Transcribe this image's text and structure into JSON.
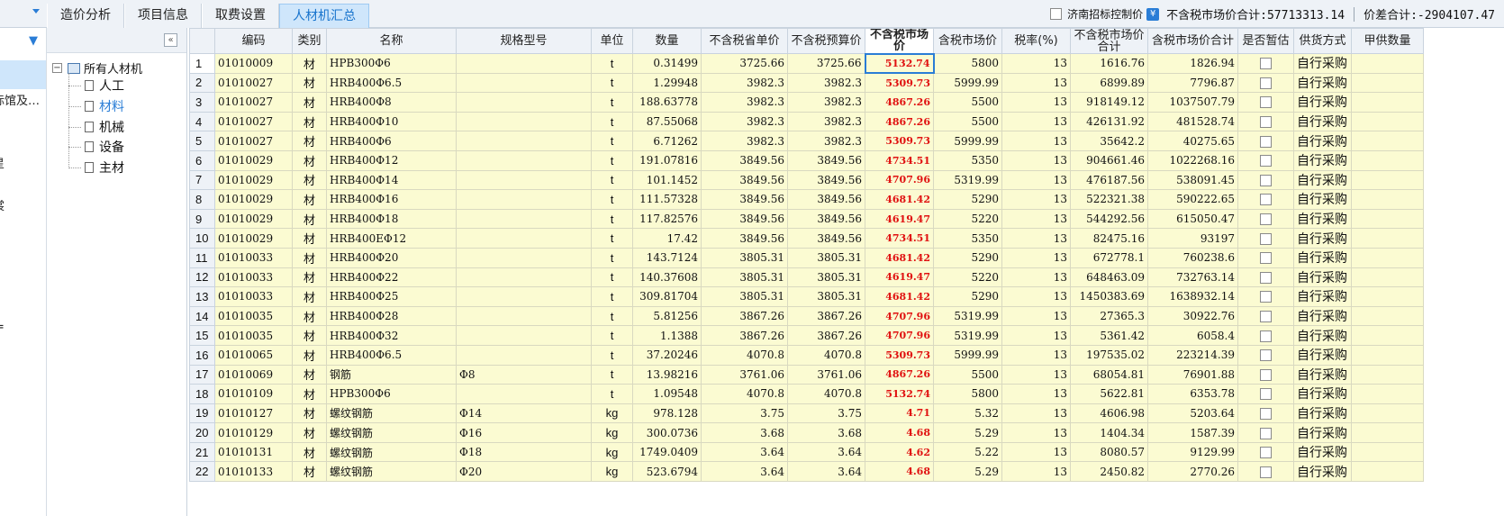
{
  "tabs": [
    {
      "label": "造价分析",
      "active": false
    },
    {
      "label": "项目信息",
      "active": false
    },
    {
      "label": "取费设置",
      "active": false
    },
    {
      "label": "人材机汇总",
      "active": true
    }
  ],
  "topright": {
    "control_label": "济南招标控制价",
    "control_checked": false,
    "tax_excluded_total": "不含税市场价合计:57713313.14",
    "price_diff_total": "价差合计:-2904107.47"
  },
  "leftnav": {
    "partial_items": [
      "标馆及…",
      "星",
      "裳",
      "="
    ]
  },
  "tree": {
    "root_label": "所有人材机",
    "root_toggle": "−",
    "children": [
      {
        "label": "人工",
        "selected": false
      },
      {
        "label": "材料",
        "selected": true
      },
      {
        "label": "机械",
        "selected": false
      },
      {
        "label": "设备",
        "selected": false
      },
      {
        "label": "主材",
        "selected": false
      }
    ],
    "collapse_glyph": "«"
  },
  "table": {
    "headers": [
      "",
      "编码",
      "类别",
      "名称",
      "规格型号",
      "单位",
      "数量",
      "不含税省单价",
      "不含税预算价",
      "不含税市场价",
      "含税市场价",
      "税率(%)",
      "不含税市场价合计",
      "含税市场价合计",
      "是否暂估",
      "供货方式",
      "甲供数量"
    ],
    "rows": [
      {
        "n": "1",
        "code": "01010009",
        "cat": "材",
        "name": "HPB300Φ6",
        "spec": "",
        "unit": "t",
        "qty": "0.31499",
        "prov": "3725.66",
        "budget": "3725.66",
        "market": "5132.74",
        "market_tax": "5800",
        "rate": "13",
        "sum": "1616.76",
        "sum_tax": "1826.94",
        "supply": "自行采购"
      },
      {
        "n": "2",
        "code": "01010027",
        "cat": "材",
        "name": "HRB400Φ6.5",
        "spec": "",
        "unit": "t",
        "qty": "1.29948",
        "prov": "3982.3",
        "budget": "3982.3",
        "market": "5309.73",
        "market_tax": "5999.99",
        "rate": "13",
        "sum": "6899.89",
        "sum_tax": "7796.87",
        "supply": "自行采购"
      },
      {
        "n": "3",
        "code": "01010027",
        "cat": "材",
        "name": "HRB400Φ8",
        "spec": "",
        "unit": "t",
        "qty": "188.63778",
        "prov": "3982.3",
        "budget": "3982.3",
        "market": "4867.26",
        "market_tax": "5500",
        "rate": "13",
        "sum": "918149.12",
        "sum_tax": "1037507.79",
        "supply": "自行采购"
      },
      {
        "n": "4",
        "code": "01010027",
        "cat": "材",
        "name": "HRB400Φ10",
        "spec": "",
        "unit": "t",
        "qty": "87.55068",
        "prov": "3982.3",
        "budget": "3982.3",
        "market": "4867.26",
        "market_tax": "5500",
        "rate": "13",
        "sum": "426131.92",
        "sum_tax": "481528.74",
        "supply": "自行采购"
      },
      {
        "n": "5",
        "code": "01010027",
        "cat": "材",
        "name": "HRB400Φ6",
        "spec": "",
        "unit": "t",
        "qty": "6.71262",
        "prov": "3982.3",
        "budget": "3982.3",
        "market": "5309.73",
        "market_tax": "5999.99",
        "rate": "13",
        "sum": "35642.2",
        "sum_tax": "40275.65",
        "supply": "自行采购"
      },
      {
        "n": "6",
        "code": "01010029",
        "cat": "材",
        "name": "HRB400Φ12",
        "spec": "",
        "unit": "t",
        "qty": "191.07816",
        "prov": "3849.56",
        "budget": "3849.56",
        "market": "4734.51",
        "market_tax": "5350",
        "rate": "13",
        "sum": "904661.46",
        "sum_tax": "1022268.16",
        "supply": "自行采购"
      },
      {
        "n": "7",
        "code": "01010029",
        "cat": "材",
        "name": "HRB400Φ14",
        "spec": "",
        "unit": "t",
        "qty": "101.1452",
        "prov": "3849.56",
        "budget": "3849.56",
        "market": "4707.96",
        "market_tax": "5319.99",
        "rate": "13",
        "sum": "476187.56",
        "sum_tax": "538091.45",
        "supply": "自行采购"
      },
      {
        "n": "8",
        "code": "01010029",
        "cat": "材",
        "name": "HRB400Φ16",
        "spec": "",
        "unit": "t",
        "qty": "111.57328",
        "prov": "3849.56",
        "budget": "3849.56",
        "market": "4681.42",
        "market_tax": "5290",
        "rate": "13",
        "sum": "522321.38",
        "sum_tax": "590222.65",
        "supply": "自行采购"
      },
      {
        "n": "9",
        "code": "01010029",
        "cat": "材",
        "name": "HRB400Φ18",
        "spec": "",
        "unit": "t",
        "qty": "117.82576",
        "prov": "3849.56",
        "budget": "3849.56",
        "market": "4619.47",
        "market_tax": "5220",
        "rate": "13",
        "sum": "544292.56",
        "sum_tax": "615050.47",
        "supply": "自行采购"
      },
      {
        "n": "10",
        "code": "01010029",
        "cat": "材",
        "name": "HRB400EΦ12",
        "spec": "",
        "unit": "t",
        "qty": "17.42",
        "prov": "3849.56",
        "budget": "3849.56",
        "market": "4734.51",
        "market_tax": "5350",
        "rate": "13",
        "sum": "82475.16",
        "sum_tax": "93197",
        "supply": "自行采购"
      },
      {
        "n": "11",
        "code": "01010033",
        "cat": "材",
        "name": "HRB400Φ20",
        "spec": "",
        "unit": "t",
        "qty": "143.7124",
        "prov": "3805.31",
        "budget": "3805.31",
        "market": "4681.42",
        "market_tax": "5290",
        "rate": "13",
        "sum": "672778.1",
        "sum_tax": "760238.6",
        "supply": "自行采购"
      },
      {
        "n": "12",
        "code": "01010033",
        "cat": "材",
        "name": "HRB400Φ22",
        "spec": "",
        "unit": "t",
        "qty": "140.37608",
        "prov": "3805.31",
        "budget": "3805.31",
        "market": "4619.47",
        "market_tax": "5220",
        "rate": "13",
        "sum": "648463.09",
        "sum_tax": "732763.14",
        "supply": "自行采购"
      },
      {
        "n": "13",
        "code": "01010033",
        "cat": "材",
        "name": "HRB400Φ25",
        "spec": "",
        "unit": "t",
        "qty": "309.81704",
        "prov": "3805.31",
        "budget": "3805.31",
        "market": "4681.42",
        "market_tax": "5290",
        "rate": "13",
        "sum": "1450383.69",
        "sum_tax": "1638932.14",
        "supply": "自行采购"
      },
      {
        "n": "14",
        "code": "01010035",
        "cat": "材",
        "name": "HRB400Φ28",
        "spec": "",
        "unit": "t",
        "qty": "5.81256",
        "prov": "3867.26",
        "budget": "3867.26",
        "market": "4707.96",
        "market_tax": "5319.99",
        "rate": "13",
        "sum": "27365.3",
        "sum_tax": "30922.76",
        "supply": "自行采购"
      },
      {
        "n": "15",
        "code": "01010035",
        "cat": "材",
        "name": "HRB400Φ32",
        "spec": "",
        "unit": "t",
        "qty": "1.1388",
        "prov": "3867.26",
        "budget": "3867.26",
        "market": "4707.96",
        "market_tax": "5319.99",
        "rate": "13",
        "sum": "5361.42",
        "sum_tax": "6058.4",
        "supply": "自行采购"
      },
      {
        "n": "16",
        "code": "01010065",
        "cat": "材",
        "name": "HRB400Φ6.5",
        "spec": "",
        "unit": "t",
        "qty": "37.20246",
        "prov": "4070.8",
        "budget": "4070.8",
        "market": "5309.73",
        "market_tax": "5999.99",
        "rate": "13",
        "sum": "197535.02",
        "sum_tax": "223214.39",
        "supply": "自行采购"
      },
      {
        "n": "17",
        "code": "01010069",
        "cat": "材",
        "name": "钢筋",
        "spec": "Φ8",
        "unit": "t",
        "qty": "13.98216",
        "prov": "3761.06",
        "budget": "3761.06",
        "market": "4867.26",
        "market_tax": "5500",
        "rate": "13",
        "sum": "68054.81",
        "sum_tax": "76901.88",
        "supply": "自行采购"
      },
      {
        "n": "18",
        "code": "01010109",
        "cat": "材",
        "name": "HPB300Φ6",
        "spec": "",
        "unit": "t",
        "qty": "1.09548",
        "prov": "4070.8",
        "budget": "4070.8",
        "market": "5132.74",
        "market_tax": "5800",
        "rate": "13",
        "sum": "5622.81",
        "sum_tax": "6353.78",
        "supply": "自行采购"
      },
      {
        "n": "19",
        "code": "01010127",
        "cat": "材",
        "name": "螺纹钢筋",
        "spec": "Φ14",
        "unit": "kg",
        "qty": "978.128",
        "prov": "3.75",
        "budget": "3.75",
        "market": "4.71",
        "market_tax": "5.32",
        "rate": "13",
        "sum": "4606.98",
        "sum_tax": "5203.64",
        "supply": "自行采购"
      },
      {
        "n": "20",
        "code": "01010129",
        "cat": "材",
        "name": "螺纹钢筋",
        "spec": "Φ16",
        "unit": "kg",
        "qty": "300.0736",
        "prov": "3.68",
        "budget": "3.68",
        "market": "4.68",
        "market_tax": "5.29",
        "rate": "13",
        "sum": "1404.34",
        "sum_tax": "1587.39",
        "supply": "自行采购"
      },
      {
        "n": "21",
        "code": "01010131",
        "cat": "材",
        "name": "螺纹钢筋",
        "spec": "Φ18",
        "unit": "kg",
        "qty": "1749.0409",
        "prov": "3.64",
        "budget": "3.64",
        "market": "4.62",
        "market_tax": "5.22",
        "rate": "13",
        "sum": "8080.57",
        "sum_tax": "9129.99",
        "supply": "自行采购"
      },
      {
        "n": "22",
        "code": "01010133",
        "cat": "材",
        "name": "螺纹钢筋",
        "spec": "Φ20",
        "unit": "kg",
        "qty": "523.6794",
        "prov": "3.64",
        "budget": "3.64",
        "market": "4.68",
        "market_tax": "5.29",
        "rate": "13",
        "sum": "2450.82",
        "sum_tax": "2770.26",
        "supply": "自行采购"
      }
    ],
    "selected_row": "1",
    "colors": {
      "row_bg": "#fbfbd2",
      "market_price_text": "#e01010",
      "selection_border": "#2a7dd6"
    }
  }
}
